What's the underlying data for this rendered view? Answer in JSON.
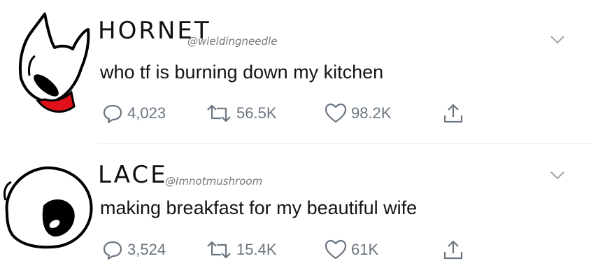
{
  "tweets": [
    {
      "name": "HORNET",
      "handle": "@wieldingneedle",
      "text": "who tf is burning down my kitchen",
      "replies": "4,023",
      "retweets": "56.5K",
      "likes": "98.2K"
    },
    {
      "name": "LACE",
      "handle": "@Imnotmushroom",
      "text": "making breakfast for my beautiful wife",
      "replies": "3,524",
      "retweets": "15.4K",
      "likes": "61K"
    }
  ],
  "colors": {
    "icon_gray": "#6b7580",
    "divider": "#e6ecf0",
    "hornet_cloak": "#e0101a"
  },
  "icons": [
    "reply-icon",
    "retweet-icon",
    "like-icon",
    "share-icon",
    "chevron-down-icon"
  ]
}
